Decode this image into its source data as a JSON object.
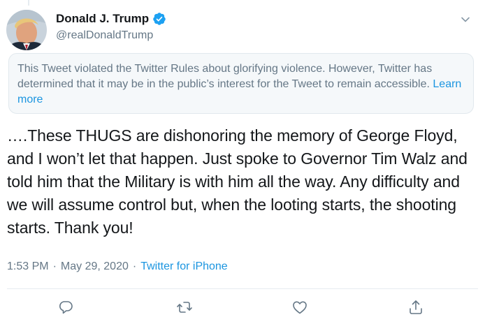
{
  "author": {
    "display_name": "Donald J. Trump",
    "handle": "@realDonaldTrump",
    "verified": true
  },
  "notice": {
    "text": "This Tweet violated the Twitter Rules about glorifying violence. However, Twitter has determined that it may be in the public’s interest for the Tweet to remain accessible. ",
    "link_label": "Learn more"
  },
  "tweet": {
    "text": "….These THUGS are dishonoring the memory of George Floyd, and I won’t let that happen. Just spoke to Governor Tim Walz and told him that the Military is with him all the way. Any difficulty and we will assume control but, when the looting starts, the shooting starts. Thank you!"
  },
  "meta": {
    "time": "1:53 PM",
    "separator": "·",
    "date": "May 29, 2020",
    "source": "Twitter for iPhone"
  },
  "icons": {
    "verified": "verified-badge-icon",
    "caret": "chevron-down-icon",
    "reply": "reply-icon",
    "retweet": "retweet-icon",
    "like": "heart-icon",
    "share": "share-icon"
  },
  "colors": {
    "link": "#1b95e0",
    "secondary_text": "#657786",
    "notice_bg": "#f5f8fa",
    "verified": "#1da1f2"
  }
}
